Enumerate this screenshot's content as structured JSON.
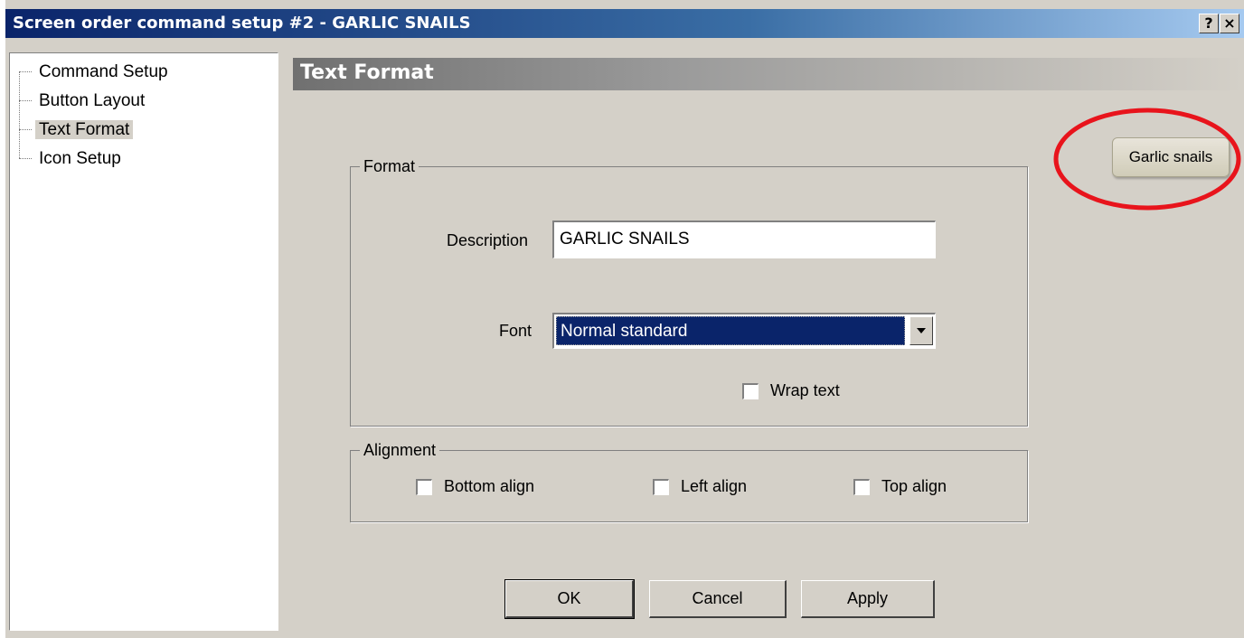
{
  "window": {
    "title": "Screen order command setup #2 - GARLIC SNAILS",
    "help_label": "?",
    "close_label": "×"
  },
  "sidebar": {
    "items": [
      {
        "label": "Command Setup",
        "selected": false
      },
      {
        "label": "Button Layout",
        "selected": false
      },
      {
        "label": "Text Format",
        "selected": true
      },
      {
        "label": "Icon Setup",
        "selected": false
      }
    ]
  },
  "header": {
    "title": "Text Format"
  },
  "format_group": {
    "legend": "Format",
    "description_label": "Description",
    "description_value": "GARLIC SNAILS",
    "font_label": "Font",
    "font_value": "Normal standard",
    "wrap_text_label": "Wrap text",
    "wrap_text_checked": false
  },
  "alignment_group": {
    "legend": "Alignment",
    "bottom_align_label": "Bottom align",
    "left_align_label": "Left align",
    "top_align_label": "Top align"
  },
  "preview": {
    "button_label": "Garlic snails",
    "highlight_color": "#e8141c"
  },
  "buttons": {
    "ok": "OK",
    "cancel": "Cancel",
    "apply": "Apply"
  }
}
